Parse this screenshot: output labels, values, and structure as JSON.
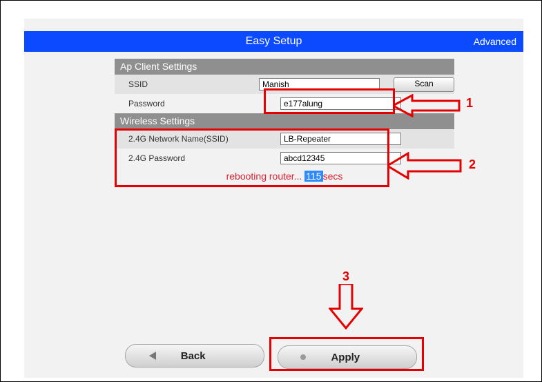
{
  "header": {
    "title": "Easy Setup",
    "advanced": "Advanced"
  },
  "ap_client": {
    "section": "Ap Client Settings",
    "ssid_label": "SSID",
    "ssid_value": "Manish",
    "scan_label": "Scan",
    "password_label": "Password",
    "password_value": "e177alung"
  },
  "wireless": {
    "section": "Wireless Settings",
    "name_label": "2.4G Network Name(SSID)",
    "name_value": "LB-Repeater",
    "password_label": "2.4G Password",
    "password_value": "abcd12345",
    "reboot_prefix": "rebooting router...",
    "reboot_count": "115",
    "reboot_suffix": "secs"
  },
  "buttons": {
    "back": "Back",
    "apply": "Apply"
  },
  "annotations": {
    "n1": "1",
    "n2": "2",
    "n3": "3"
  }
}
